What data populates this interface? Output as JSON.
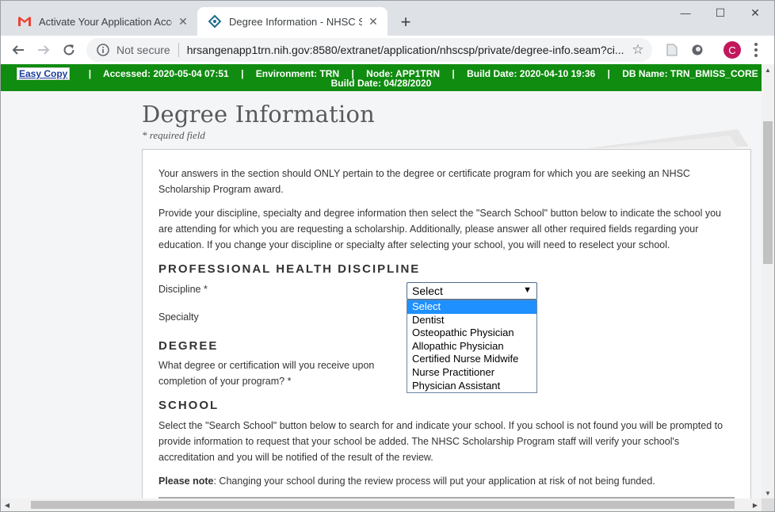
{
  "browser": {
    "tabs": [
      {
        "title": "Activate Your Application Accoun",
        "close": "✕"
      },
      {
        "title": "Degree Information - NHSC Scho",
        "close": "✕"
      }
    ],
    "new_tab": "+",
    "window_controls": {
      "minimize": "—",
      "maximize": "☐",
      "close": "✕"
    },
    "not_secure": "Not secure",
    "url": "hrsangenapp1trn.nih.gov:8580/extranet/application/nhscsp/private/degree-info.seam?ci...",
    "profile_initial": "C",
    "profile_color": "#c2185b"
  },
  "env_bar": {
    "easy_copy": "Easy Copy",
    "separator": "|",
    "accessed": "Accessed: 2020-05-04 07:51",
    "environment": "Environment: TRN",
    "node": "Node: APP1TRN",
    "build_date": "Build Date: 2020-04-10 19:36",
    "db_name": "DB Name: TRN_BMISS_CORE",
    "db_prefix": "DB",
    "db_build_date": "Build Date: 04/28/2020",
    "color": "#108c10"
  },
  "page": {
    "title": "Degree Information",
    "required_note": "* required field",
    "intro1": "Your answers in the section should ONLY pertain to the degree or certificate program for which you are seeking an NHSC Scholarship Program award.",
    "intro2": "Provide your discipline, specialty and degree information then select the \"Search School\" button below to indicate the school you are attending for which you are requesting a scholarship. Additionally, please answer all other required fields regarding your education. If you change your discipline or specialty after selecting your school, you will need to reselect your school.",
    "section_discipline": "PROFESSIONAL HEALTH DISCIPLINE",
    "discipline_label": "Discipline *",
    "specialty_label": "Specialty",
    "section_degree": "DEGREE",
    "degree_question": "What degree or certification will you receive upon completion of your program? *",
    "section_school": "SCHOOL",
    "school_text": "Select the \"Search School\" button below to search for and indicate your school. If you school is not found you will be prompted to provide information to request that your school be added. The NHSC Scholarship Program staff will verify your school's accreditation and you will be notified of the result of the review.",
    "note_label": "Please note",
    "note_text": ": Changing your school during the review process will put your application at risk of not being funded."
  },
  "discipline_select": {
    "value": "Select",
    "arrow": "▼",
    "options": [
      "Select",
      "Dentist",
      "Osteopathic Physician",
      "Allopathic Physician",
      "Certified Nurse Midwife",
      "Nurse Practitioner",
      "Physician Assistant"
    ],
    "highlight_color": "#1e90ff"
  }
}
